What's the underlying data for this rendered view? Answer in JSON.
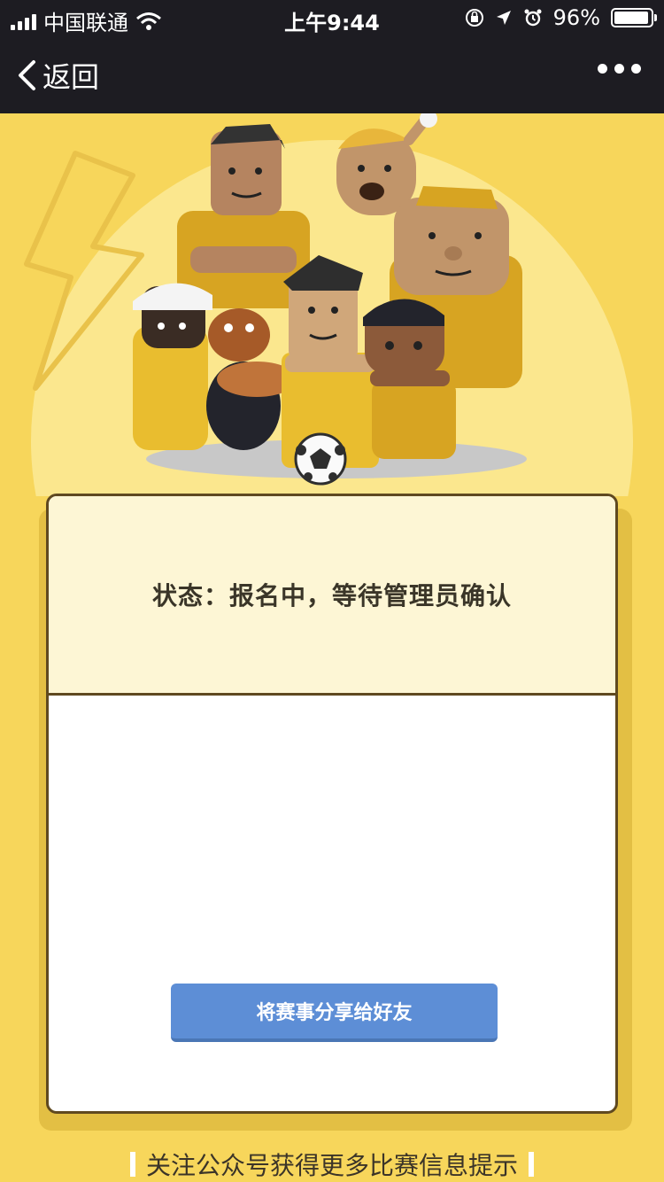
{
  "status_bar": {
    "carrier": "中国联通",
    "time": "上午9:44",
    "battery": "96%",
    "battery_level": 0.96
  },
  "nav": {
    "back_label": "返回"
  },
  "card": {
    "status": "状态：报名中，等待管理员确认",
    "share_button": "将赛事分享给好友"
  },
  "footer": {
    "follow_text": "关注公众号获得更多比赛信息提示"
  },
  "colors": {
    "background": "#f7d65b",
    "topbar": "#1d1c22",
    "share_button": "#5d8ed6"
  }
}
